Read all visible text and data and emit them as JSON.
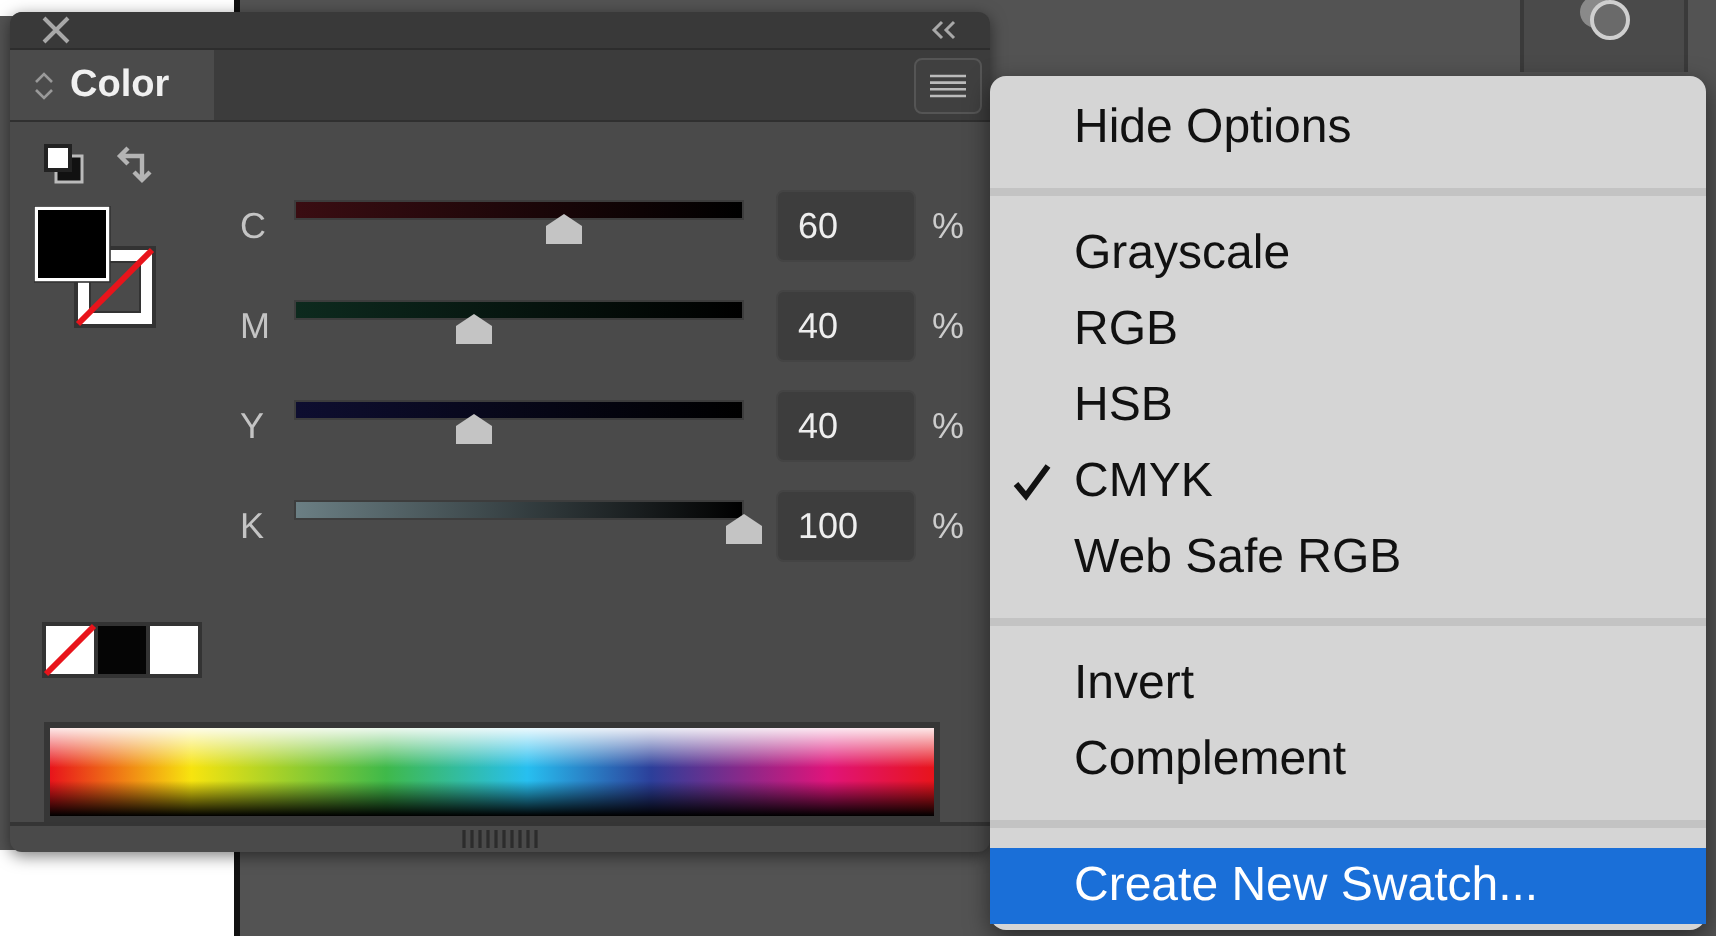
{
  "panel": {
    "tab": {
      "label": "Color",
      "selected": true
    },
    "sliders": [
      {
        "label": "C",
        "value": "60",
        "unit": "%",
        "level": 0.6,
        "color": "#3a0d12"
      },
      {
        "label": "M",
        "value": "40",
        "unit": "%",
        "level": 0.4,
        "color": "#0d2a1e"
      },
      {
        "label": "Y",
        "value": "40",
        "unit": "%",
        "level": 0.4,
        "color": "#0e0e30"
      },
      {
        "label": "K",
        "value": "100",
        "unit": "%",
        "level": 1.0,
        "color": "#6b7f84"
      }
    ]
  },
  "menu": {
    "sections": [
      {
        "items": [
          {
            "label": "Hide Options",
            "checked": false,
            "selected": false
          }
        ]
      },
      {
        "items": [
          {
            "label": "Grayscale",
            "checked": false,
            "selected": false
          },
          {
            "label": "RGB",
            "checked": false,
            "selected": false
          },
          {
            "label": "HSB",
            "checked": false,
            "selected": false
          },
          {
            "label": "CMYK",
            "checked": true,
            "selected": false
          },
          {
            "label": "Web Safe RGB",
            "checked": false,
            "selected": false
          }
        ]
      },
      {
        "items": [
          {
            "label": "Invert",
            "checked": false,
            "selected": false
          },
          {
            "label": "Complement",
            "checked": false,
            "selected": false
          }
        ]
      },
      {
        "items": [
          {
            "label": "Create New Swatch...",
            "checked": false,
            "selected": true
          }
        ]
      }
    ]
  }
}
